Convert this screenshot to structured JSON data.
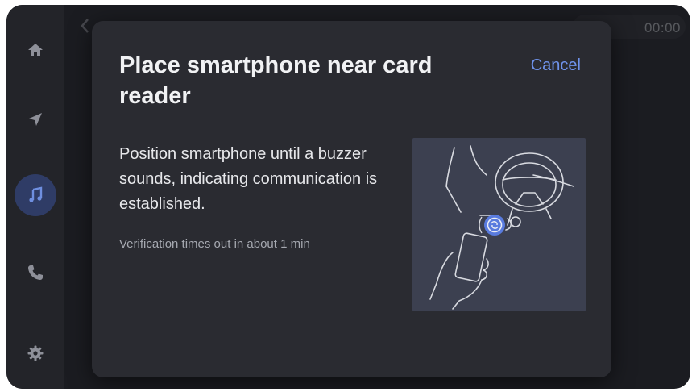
{
  "nav_rail": {
    "items": [
      {
        "name": "home",
        "icon": "home-icon",
        "active": false
      },
      {
        "name": "navigation",
        "icon": "navigation-arrow-icon",
        "active": false
      },
      {
        "name": "media",
        "icon": "music-note-icon",
        "active": true
      },
      {
        "name": "phone",
        "icon": "phone-icon",
        "active": false
      },
      {
        "name": "settings",
        "icon": "gear-icon",
        "active": false
      }
    ]
  },
  "status_bar": {
    "clock": "00:00"
  },
  "dialog": {
    "title": "Place smartphone near card reader",
    "cancel_label": "Cancel",
    "body": "Position smartphone until a buzzer sounds, indicating communication is established.",
    "timeout_note": "Verification times out in about 1 min",
    "illustration_icon": "smartphone-nfc-card-reader-icon"
  },
  "colors": {
    "background": "#1b1c21",
    "dialog": "#2a2b31",
    "accent": "#6f93ec",
    "active_nav": "#2f3c66"
  }
}
